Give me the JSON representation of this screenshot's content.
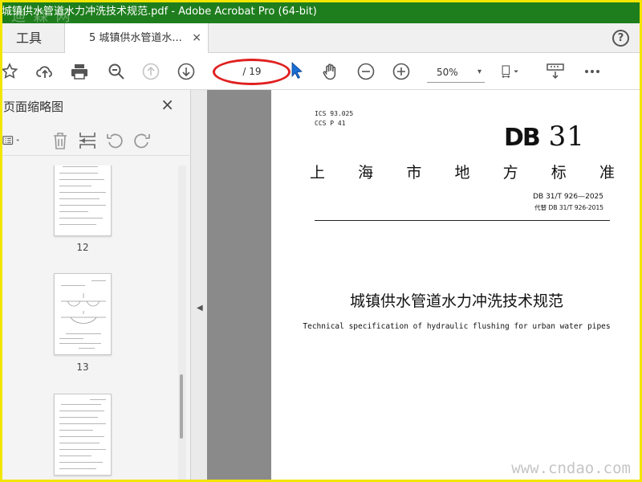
{
  "window": {
    "title": "城镇供水管道水力冲洗技术规范.pdf - Adobe Acrobat Pro (64-bit)",
    "watermark_top": "迪 森 网",
    "watermark_bottom": "www.cndao.com"
  },
  "tabs": {
    "tools_label": "工具",
    "doc_label": "5 城镇供水管道水...",
    "close_glyph": "×",
    "help_glyph": "?"
  },
  "toolbar": {
    "page_indicator": "/ 19",
    "zoom_value": "50%",
    "zoom_caret": "▾"
  },
  "sidebar": {
    "title": "页面缩略图",
    "close_glyph": "×",
    "thumbnails": [
      {
        "label": "12"
      },
      {
        "label": "13"
      },
      {
        "label": ""
      }
    ]
  },
  "document": {
    "ics_line": "ICS  93.025",
    "ccs_line": "CCS  P 41",
    "db_bold": "DB",
    "db_num": "31",
    "standard_type_chars": [
      "上",
      "海",
      "市",
      "地",
      "方",
      "标",
      "准"
    ],
    "std_number": "DB 31/T 926—2025",
    "replaces": "代替 DB 31/T 926-2015",
    "title_cn": "城镇供水管道水力冲洗技术规范",
    "title_en": "Technical specification of hydraulic flushing for urban water pipes"
  },
  "colors": {
    "titlebar_bg": "#1e7e1e",
    "frame": "#f2e600",
    "highlight_ellipse": "#e02020",
    "cursor": "#1a6fd6"
  }
}
